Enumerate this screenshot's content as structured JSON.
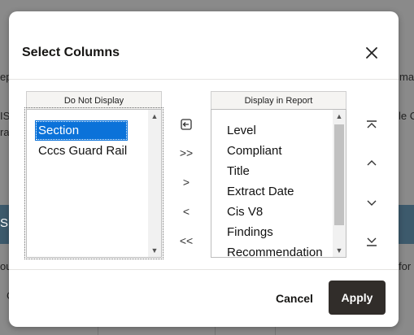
{
  "background": {
    "fragments": [
      "ep",
      "ma",
      "IS",
      "ra",
      "le C",
      "S",
      "ou",
      "for",
      "C"
    ]
  },
  "dialog": {
    "title": "Select Columns",
    "do_not_display": {
      "header": "Do Not Display",
      "items": [
        "Section",
        "Cccs Guard Rail"
      ],
      "selected": "Section"
    },
    "display_in_report": {
      "header": "Display in Report",
      "items": [
        "Level",
        "Compliant",
        "Title",
        "Extract Date",
        "Cis V8",
        "Findings",
        "Recommendation"
      ]
    },
    "move_controls": [
      "reset-icon",
      "move-all-right-icon",
      "move-right-icon",
      "move-left-icon",
      "move-all-left-icon"
    ],
    "order_controls": [
      "move-top-icon",
      "move-up-icon",
      "move-down-icon",
      "move-bottom-icon"
    ],
    "footer": {
      "cancel_label": "Cancel",
      "apply_label": "Apply"
    }
  }
}
